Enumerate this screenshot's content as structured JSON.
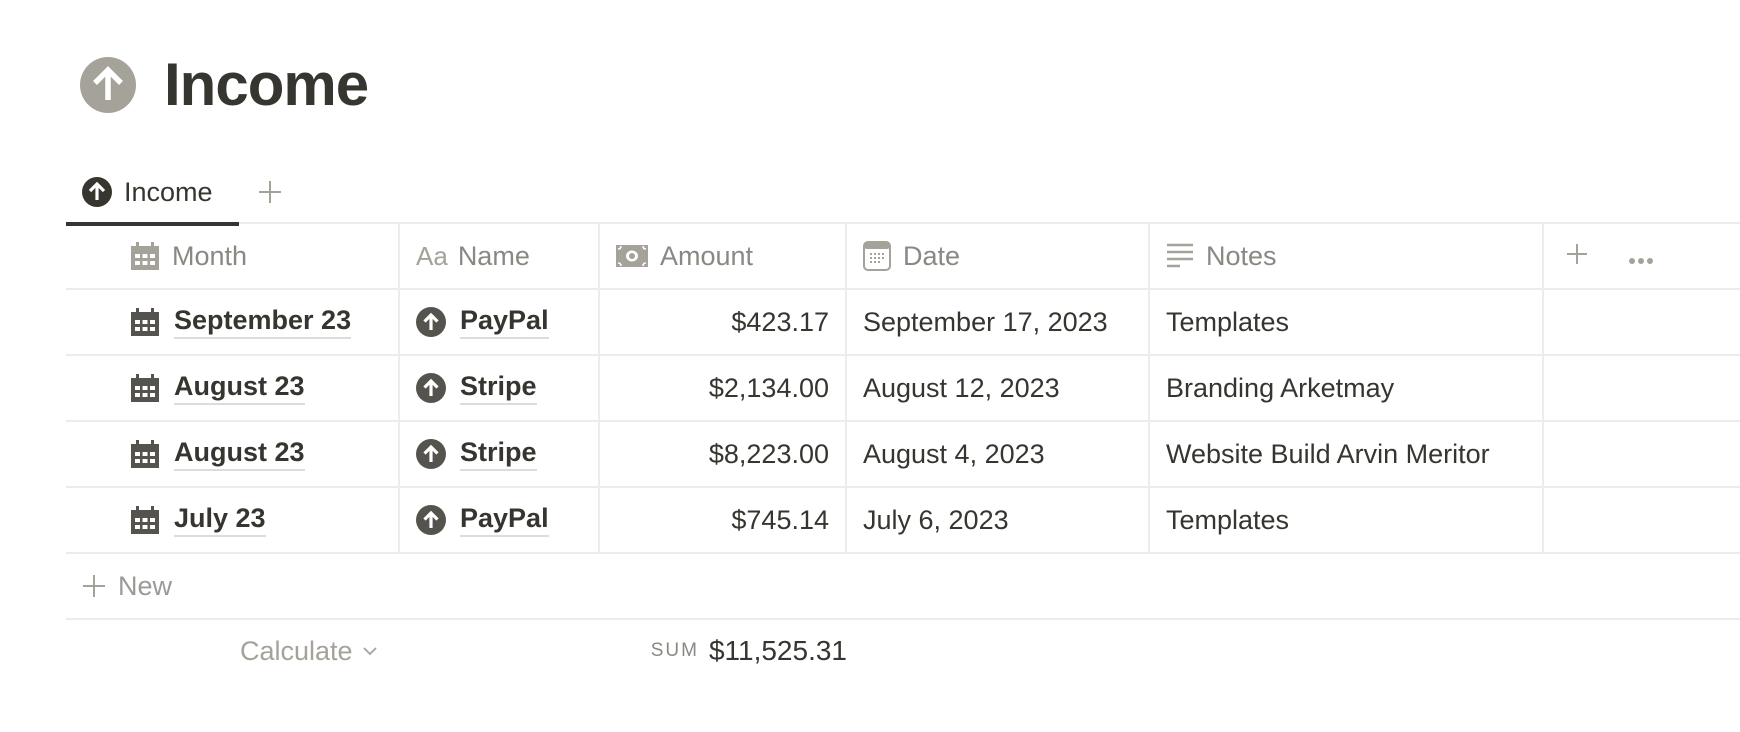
{
  "page": {
    "title": "Income",
    "icon": "arrow-up-circle-icon"
  },
  "tabs": [
    {
      "label": "Income",
      "icon": "arrow-up-circle-icon",
      "active": true
    }
  ],
  "table": {
    "columns": [
      {
        "key": "month",
        "label": "Month",
        "icon": "calendar-icon"
      },
      {
        "key": "name",
        "label": "Name",
        "icon": "text-aa-icon",
        "icon_text": "Aa"
      },
      {
        "key": "amount",
        "label": "Amount",
        "icon": "banknote-icon"
      },
      {
        "key": "date",
        "label": "Date",
        "icon": "date-icon"
      },
      {
        "key": "notes",
        "label": "Notes",
        "icon": "lines-icon"
      }
    ],
    "rows": [
      {
        "month": "September 23",
        "name": "PayPal",
        "amount": "$423.17",
        "date": "September 17, 2023",
        "notes": "Templates"
      },
      {
        "month": "August 23",
        "name": "Stripe",
        "amount": "$2,134.00",
        "date": "August 12, 2023",
        "notes": "Branding Arketmay"
      },
      {
        "month": "August 23",
        "name": "Stripe",
        "amount": "$8,223.00",
        "date": "August 4, 2023",
        "notes": "Website Build Arvin Meritor"
      },
      {
        "month": "July 23",
        "name": "PayPal",
        "amount": "$745.14",
        "date": "July 6, 2023",
        "notes": "Templates"
      }
    ],
    "new_label": "New",
    "calculate_label": "Calculate",
    "sum_label": "SUM",
    "sum_value": "$11,525.31"
  },
  "colors": {
    "text": "#37352f",
    "muted": "#8a8883",
    "border": "#ececeb",
    "title_icon_bg": "#a5a29a"
  }
}
